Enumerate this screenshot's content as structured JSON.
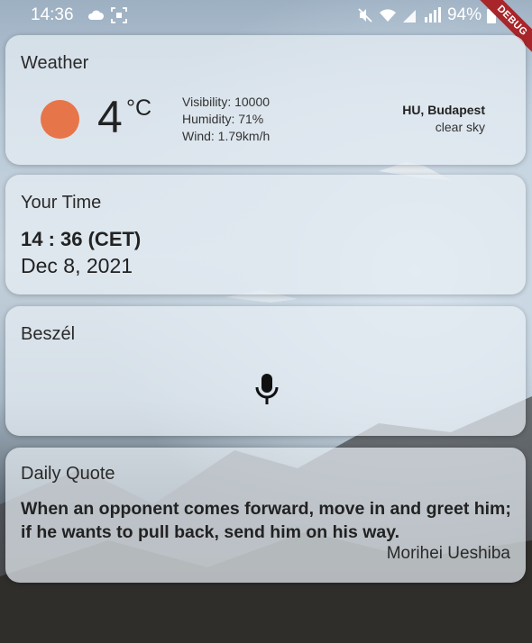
{
  "status_bar": {
    "time": "14:36",
    "battery": "94%",
    "debug_label": "DEBUG"
  },
  "weather": {
    "title": "Weather",
    "temperature": "4",
    "unit": "°C",
    "visibility": "Visibility: 10000",
    "humidity": "Humidity: 71%",
    "wind": "Wind: 1.79km/h",
    "location": "HU, Budapest",
    "condition": "clear sky",
    "icon": "sun-icon",
    "sun_color": "#e7754a"
  },
  "time_card": {
    "title": "Your Time",
    "time": "14 : 36 (CET)",
    "date": "Dec 8, 2021"
  },
  "speak_card": {
    "title": "Beszél",
    "icon": "microphone-icon"
  },
  "quote_card": {
    "title": "Daily Quote",
    "text": "When an opponent comes forward, move in and greet him; if he wants to pull back, send him on his way.",
    "author": "Morihei Ueshiba"
  }
}
